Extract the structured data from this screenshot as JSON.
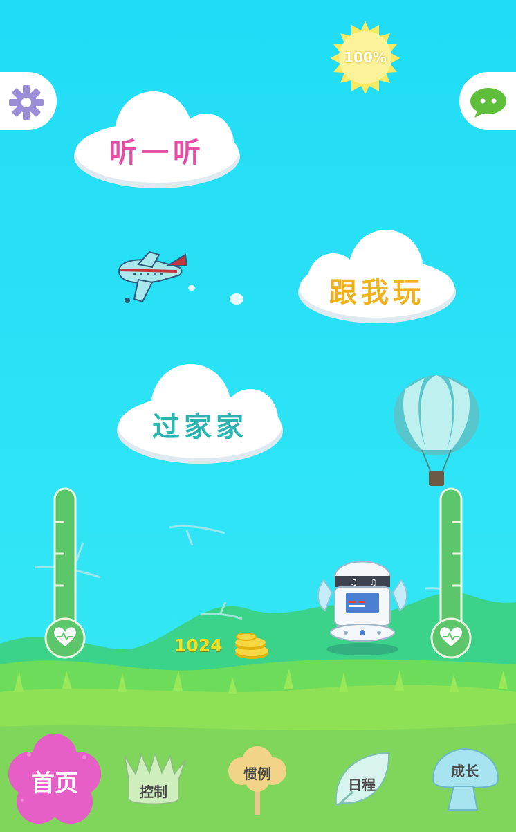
{
  "battery": {
    "level_text": "100%",
    "level": 1.0
  },
  "top": {
    "settings_icon": "gear-icon",
    "chat_icon": "chat-icon"
  },
  "menu": {
    "listen_label": "听一听",
    "play_label": "跟我玩",
    "house_label": "过家家"
  },
  "coins": {
    "count": "1024"
  },
  "gauges": {
    "left_icon": "heart-pulse-icon",
    "right_icon": "heart-pulse-icon"
  },
  "nav": {
    "home": "首页",
    "control": "控制",
    "habits": "惯例",
    "schedule": "日程",
    "growth": "成长"
  },
  "colors": {
    "sky": "#26e2f7",
    "listen": "#e24fa4",
    "play": "#f0b21c",
    "house": "#2bb5b0",
    "home_flower": "#e65fc6",
    "gauge": "#5cc76a"
  }
}
